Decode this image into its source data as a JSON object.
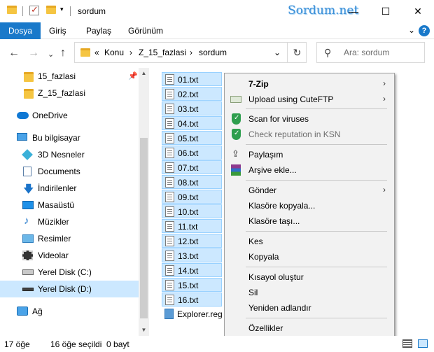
{
  "window": {
    "title": "sordum",
    "brand": "Sordum.net",
    "controls": {
      "minimize": "—",
      "maximize": "☐",
      "close": "✕"
    }
  },
  "ribbon": {
    "tabs": [
      {
        "label": "Dosya",
        "active": true
      },
      {
        "label": "Giriş"
      },
      {
        "label": "Paylaş"
      },
      {
        "label": "Görünüm"
      }
    ],
    "expand": "⌄",
    "help": "?"
  },
  "nav": {
    "back": "←",
    "forward": "→",
    "recent": "⌄",
    "up": "↑",
    "overflow": "«",
    "breadcrumb": [
      "Konu",
      "Z_15_fazlasi",
      "sordum"
    ],
    "separator": "›",
    "dropdown": "⌄",
    "refresh": "↻",
    "search_placeholder": "Ara: sordum"
  },
  "sidebar": {
    "items": [
      {
        "label": "15_fazlasi",
        "icon": "folder-icon",
        "pinned": true
      },
      {
        "label": "Z_15_fazlasi",
        "icon": "folder-icon"
      },
      {
        "label": "OneDrive",
        "icon": "cloud-icon"
      },
      {
        "label": "Bu bilgisayar",
        "icon": "computer-icon"
      },
      {
        "label": "3D Nesneler",
        "icon": "cube-icon"
      },
      {
        "label": "Documents",
        "icon": "documents-icon"
      },
      {
        "label": "İndirilenler",
        "icon": "download-icon"
      },
      {
        "label": "Masaüstü",
        "icon": "desktop-icon"
      },
      {
        "label": "Müzikler",
        "icon": "music-icon"
      },
      {
        "label": "Resimler",
        "icon": "pictures-icon"
      },
      {
        "label": "Videolar",
        "icon": "videos-icon"
      },
      {
        "label": "Yerel Disk (C:)",
        "icon": "drive-c-icon"
      },
      {
        "label": "Yerel Disk (D:)",
        "icon": "drive-d-icon",
        "selected": true
      },
      {
        "label": "Ağ",
        "icon": "network-icon"
      }
    ]
  },
  "files": {
    "items": [
      {
        "name": "01.txt",
        "selected": true
      },
      {
        "name": "02.txt",
        "selected": true
      },
      {
        "name": "03.txt",
        "selected": true
      },
      {
        "name": "04.txt",
        "selected": true
      },
      {
        "name": "05.txt",
        "selected": true
      },
      {
        "name": "06.txt",
        "selected": true
      },
      {
        "name": "07.txt",
        "selected": true
      },
      {
        "name": "08.txt",
        "selected": true
      },
      {
        "name": "09.txt",
        "selected": true
      },
      {
        "name": "10.txt",
        "selected": true
      },
      {
        "name": "11.txt",
        "selected": true
      },
      {
        "name": "12.txt",
        "selected": true
      },
      {
        "name": "13.txt",
        "selected": true
      },
      {
        "name": "14.txt",
        "selected": true
      },
      {
        "name": "15.txt",
        "selected": true
      },
      {
        "name": "16.txt",
        "selected": true
      },
      {
        "name": "Explorer.reg",
        "selected": false
      }
    ]
  },
  "context_menu": {
    "items": [
      {
        "label": "7-Zip",
        "bold": true,
        "submenu": true
      },
      {
        "label": "Upload using CuteFTP",
        "icon": "cuteftp-icon",
        "submenu": true
      },
      {
        "label": "Scan for viruses",
        "icon": "kaspersky-shield-icon"
      },
      {
        "label": "Check reputation in KSN",
        "icon": "kaspersky-shield-icon",
        "disabled": true
      },
      {
        "label": "Paylaşım",
        "icon": "share-icon"
      },
      {
        "label": "Arşive ekle...",
        "icon": "winrar-icon"
      },
      {
        "label": "Gönder",
        "submenu": true
      },
      {
        "label": "Klasöre kopyala..."
      },
      {
        "label": "Klasöre taşı..."
      },
      {
        "label": "Kes"
      },
      {
        "label": "Kopyala"
      },
      {
        "label": "Kısayol oluştur"
      },
      {
        "label": "Sil"
      },
      {
        "label": "Yeniden adlandır"
      },
      {
        "label": "Özellikler"
      }
    ],
    "submenu_arrow": "›"
  },
  "status": {
    "item_count": "17 öğe",
    "selection": "16 öğe seçildi  0 bayt"
  },
  "colors": {
    "accent": "#1979ca",
    "selection": "#cce8ff",
    "selection_border": "#99d1ff",
    "folder": "#f5c542"
  }
}
